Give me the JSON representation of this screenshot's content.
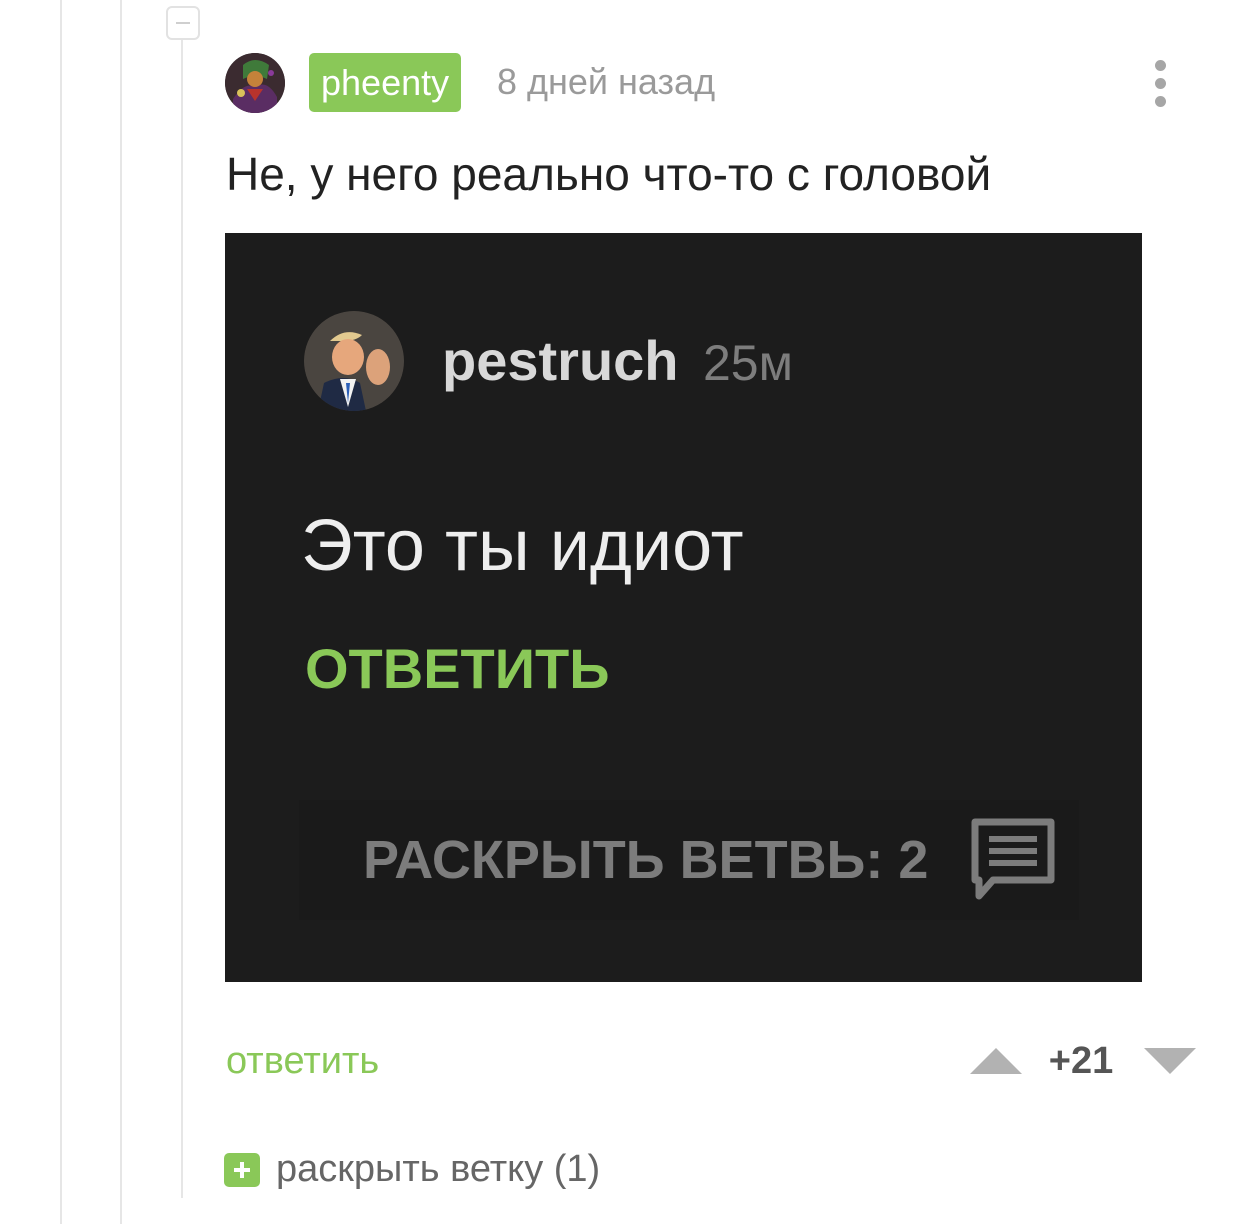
{
  "comment": {
    "username": "pheenty",
    "timestamp": "8 дней назад",
    "text": "Не, у него реально что-то с головой",
    "reply_label": "ответить",
    "rating": "+21",
    "expand_branch_label": "раскрыть ветку (1)"
  },
  "embedded_screenshot": {
    "username": "pestruch",
    "timestamp": "25м",
    "text": "Это ты идиот",
    "reply_label": "ОТВЕТИТЬ",
    "expand_label": "РАСКРЫТЬ ВЕТВЬ: 2",
    "icon": "comment-icon"
  },
  "colors": {
    "accent_green": "#8ac858",
    "muted_gray": "#a6a6a6",
    "dark_background": "#1c1c1c"
  },
  "icons": {
    "collapse": "minus-icon",
    "more": "more-vertical-icon",
    "upvote": "triangle-up-icon",
    "downvote": "triangle-down-icon",
    "expand": "plus-icon"
  }
}
